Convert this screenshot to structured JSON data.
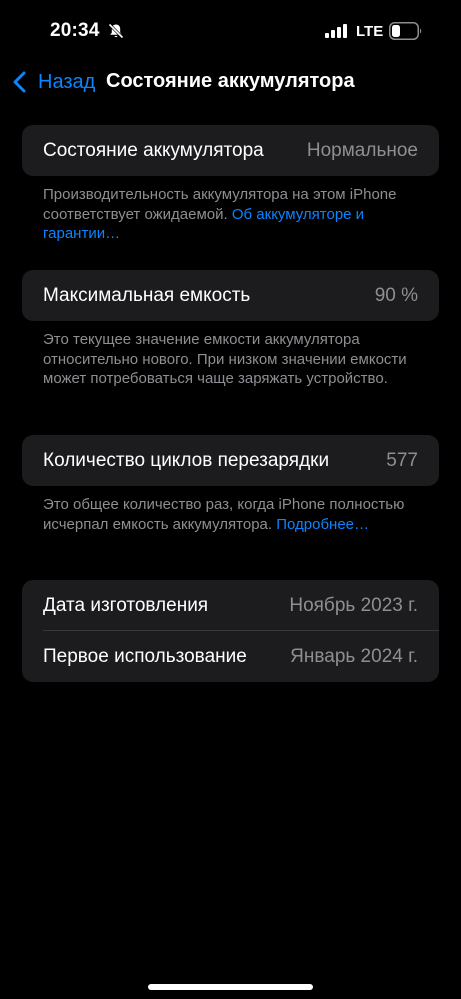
{
  "status": {
    "time": "20:34",
    "network": "LTE"
  },
  "nav": {
    "back_label": "Назад",
    "title": "Состояние аккумулятора"
  },
  "battery_health": {
    "label": "Состояние аккумулятора",
    "value": "Нормальное",
    "footer_text": "Производительность аккумулятора на этом iPhone соответствует ожидаемой. ",
    "footer_link": "Об аккумуляторе и гарантии…"
  },
  "max_capacity": {
    "label": "Максимальная емкость",
    "value": "90 %",
    "footer_text": "Это текущее значение емкости аккумулятора относительно нового. При низком значении емкости может потребоваться чаще заряжать устройство."
  },
  "cycle_count": {
    "label": "Количество циклов перезарядки",
    "value": "577",
    "footer_text": "Это общее количество раз, когда iPhone полностью исчерпал емкость аккумулятора. ",
    "footer_link": "Подробнее…"
  },
  "dates": {
    "manufacture_label": "Дата изготовления",
    "manufacture_value": "Ноябрь 2023 г.",
    "first_use_label": "Первое использование",
    "first_use_value": "Январь 2024 г."
  },
  "colors": {
    "accent": "#0a84ff",
    "card": "#1c1c1e",
    "secondary_text": "#8e8e93",
    "background": "#000000"
  },
  "icons": [
    "bell-slash-icon",
    "cellular-signal-icon",
    "battery-icon",
    "chevron-left-icon"
  ]
}
